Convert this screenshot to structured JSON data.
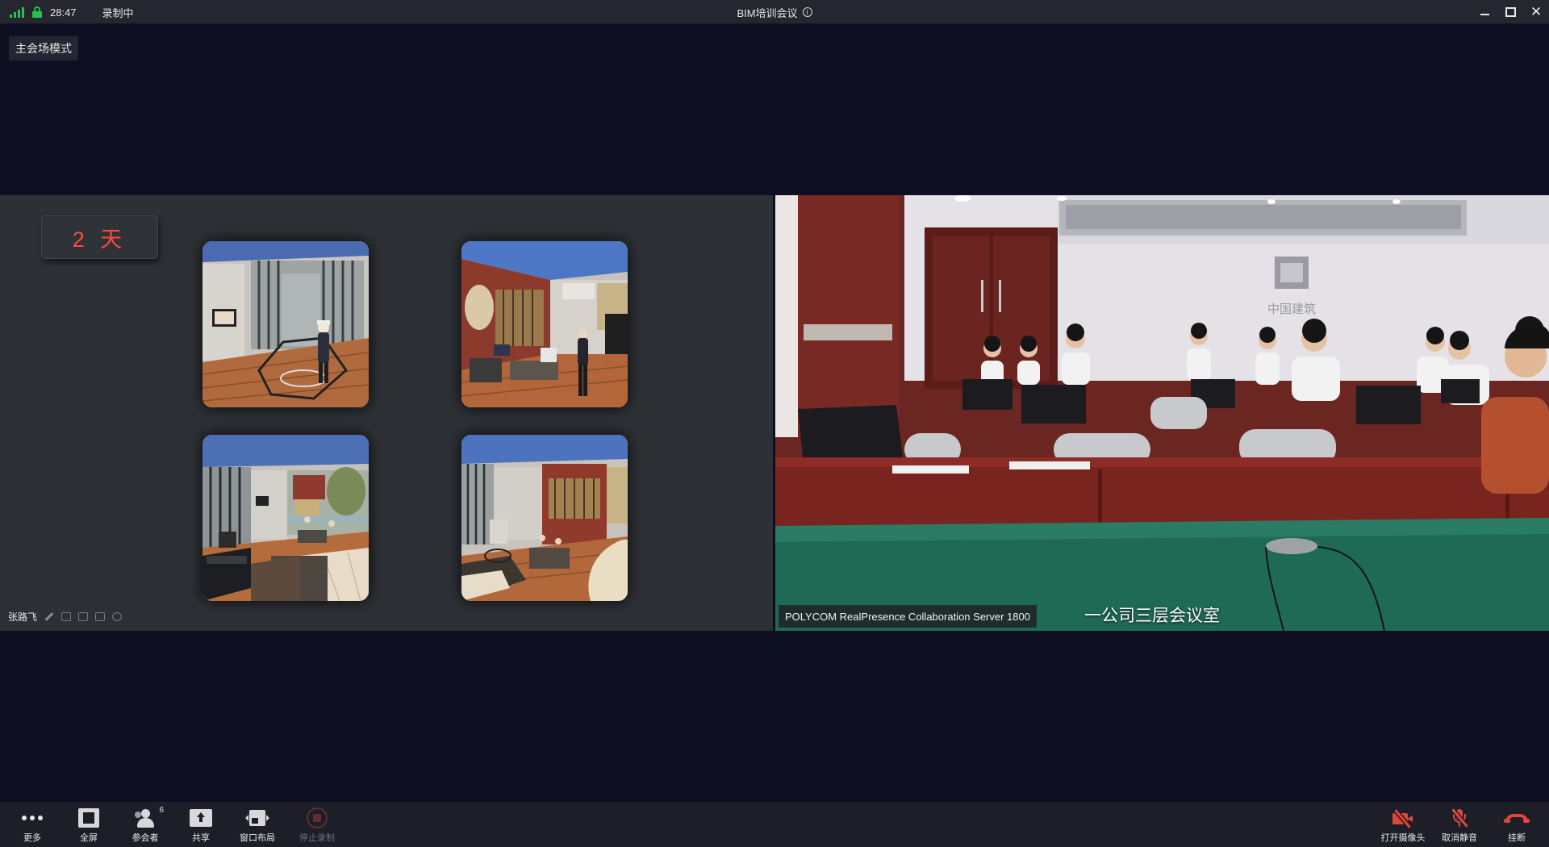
{
  "status": {
    "time": "28:47",
    "recording": "录制中"
  },
  "window": {
    "title": "BIM培训会议",
    "info_icon": "ⓘ"
  },
  "mode_badge": "主会场模式",
  "left_video": {
    "day_label": "2 天",
    "speaker": "张路飞"
  },
  "right_video": {
    "source": "POLYCOM RealPresence Collaboration Server 1800",
    "room_name": "一公司三层会议室",
    "wall_logo": "中国建筑"
  },
  "toolbar": {
    "more": "更多",
    "fullscreen": "全屏",
    "participants": "参会者",
    "participants_count": "6",
    "share": "共享",
    "layout": "窗口布局",
    "stop_record": "停止录制",
    "camera": "打开摄像头",
    "mute": "取消静音",
    "hangup": "挂断"
  },
  "colors": {
    "accent_red": "#e0473c",
    "status_green": "#27c24c",
    "day_text": "#ff4a3a"
  }
}
